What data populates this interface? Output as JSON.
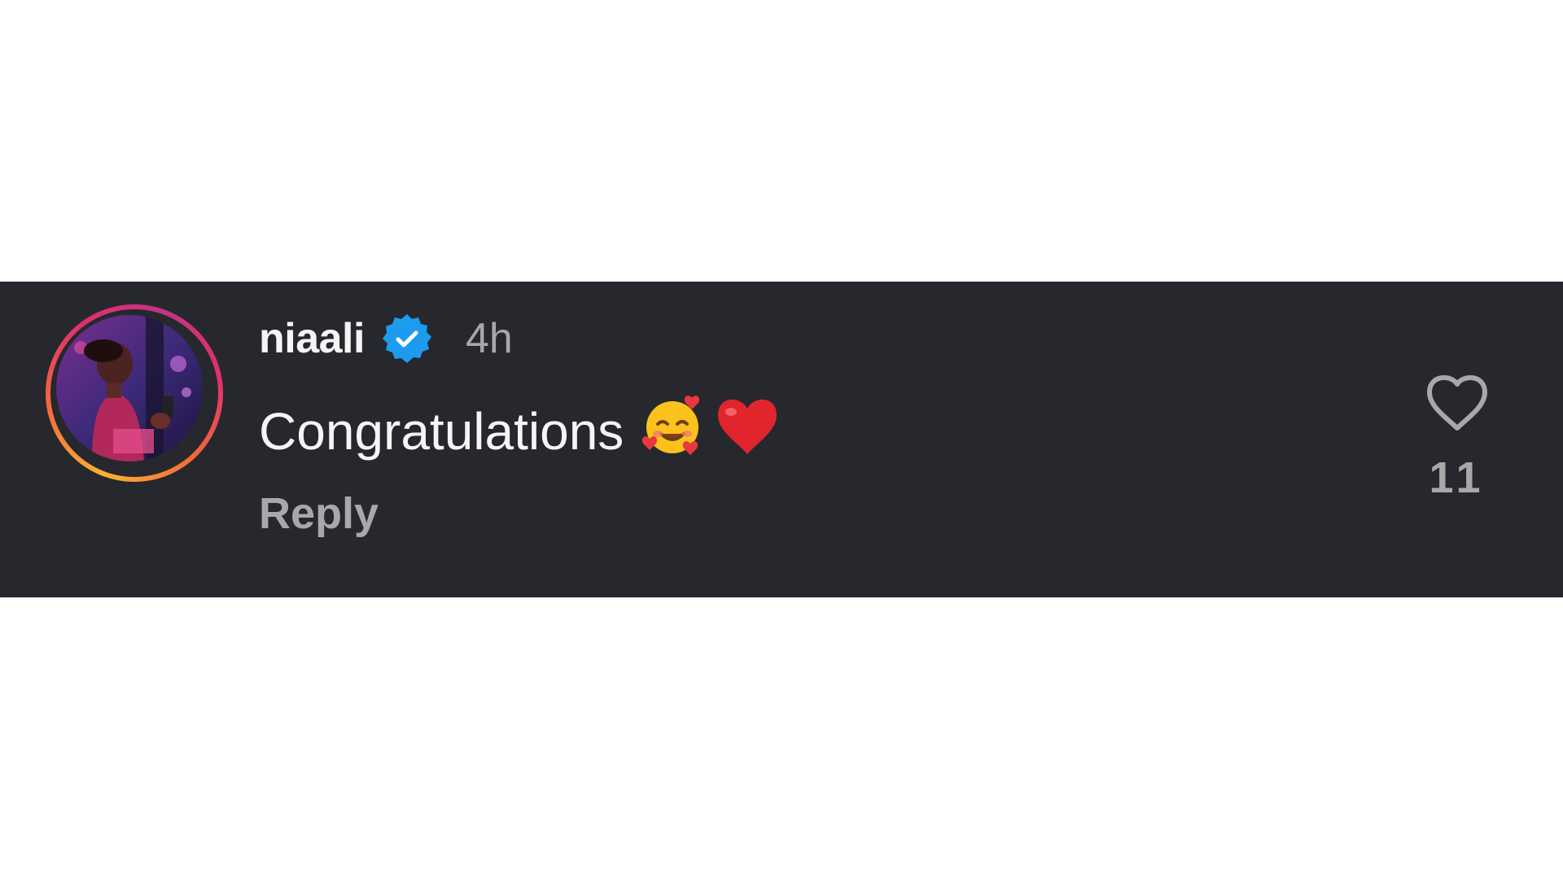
{
  "comment": {
    "username": "niaali",
    "verified": true,
    "time": "4h",
    "text": "Congratulations",
    "emojis": [
      "smiling-face-with-hearts",
      "red-heart"
    ],
    "reply_label": "Reply",
    "like_count": "11"
  },
  "colors": {
    "background": "#26282d",
    "primary_text": "#f5f5f5",
    "secondary_text": "#a8a8a8",
    "verified_blue": "#1d9bf0",
    "story_ring": [
      "#f9b233",
      "#e1306c",
      "#c13584"
    ]
  }
}
